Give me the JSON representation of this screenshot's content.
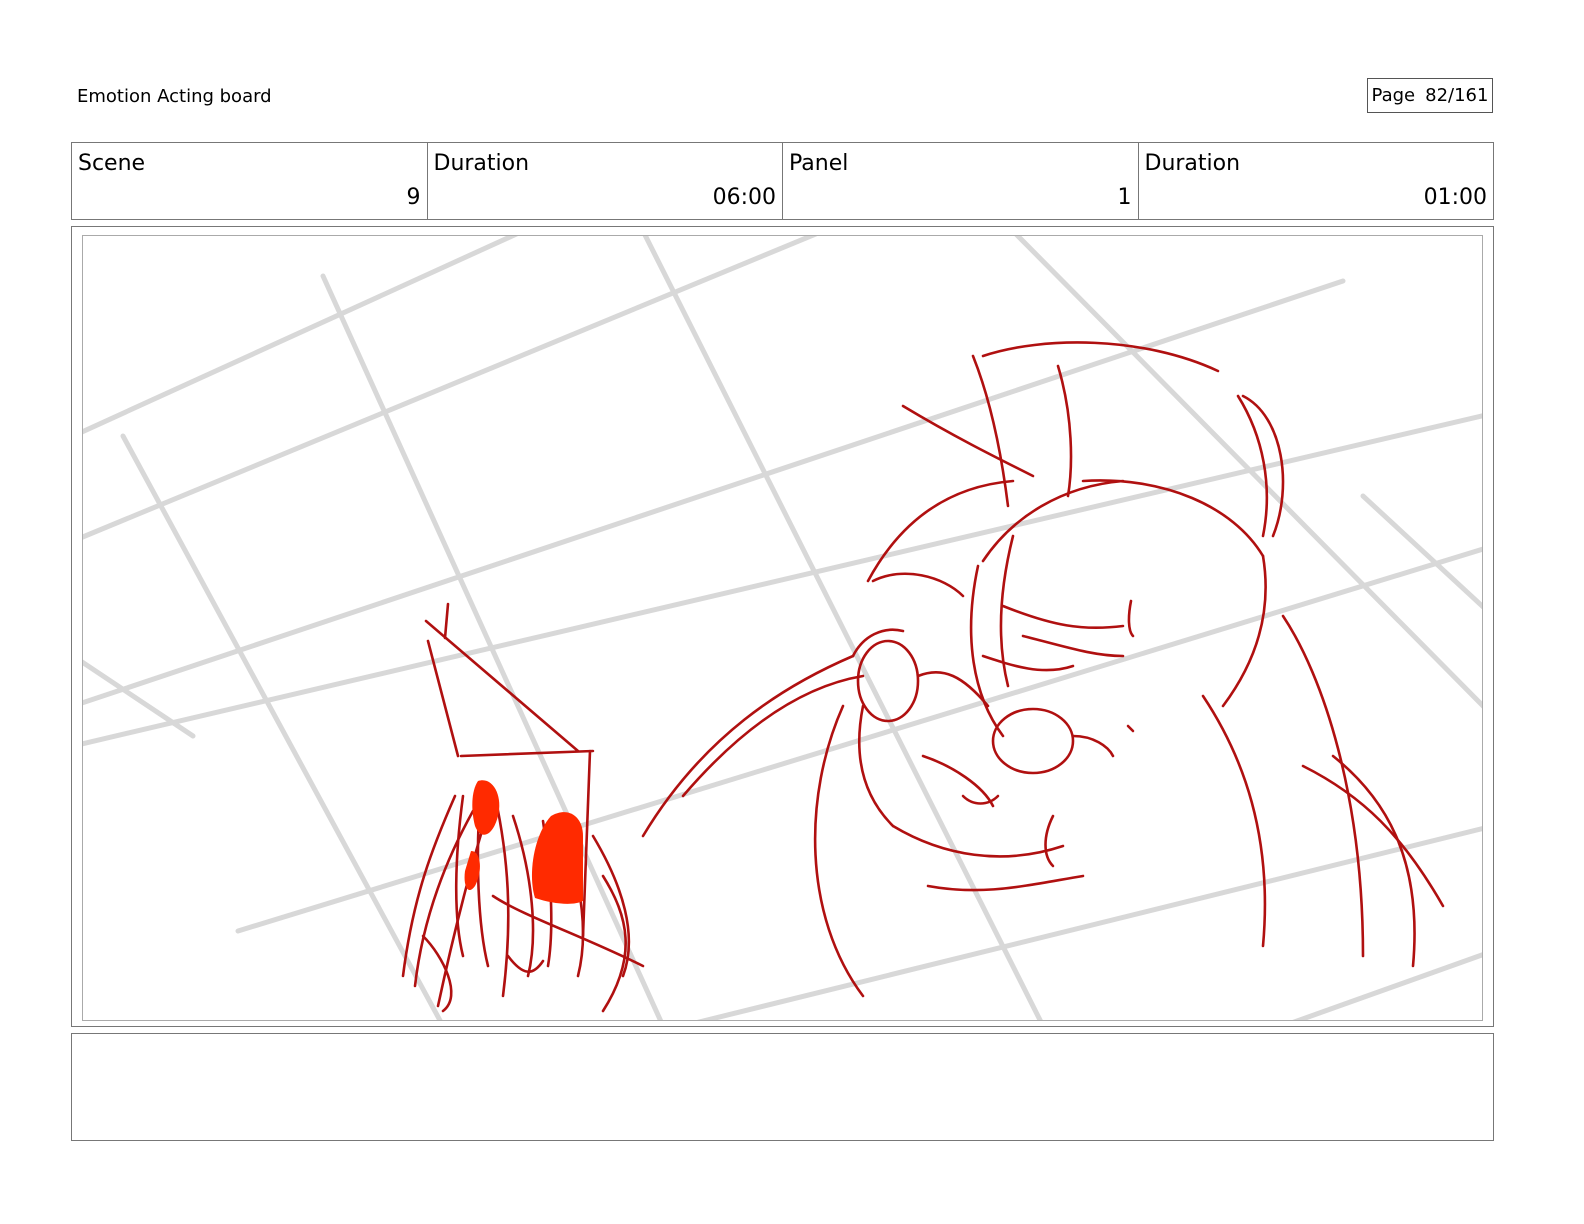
{
  "board": {
    "title": "Emotion Acting board",
    "page_label": "Page",
    "page_number": "82/161"
  },
  "info": {
    "scene_label": "Scene",
    "scene_value": "9",
    "scene_duration_label": "Duration",
    "scene_duration_value": "06:00",
    "panel_label": "Panel",
    "panel_value": "1",
    "panel_duration_label": "Duration",
    "panel_duration_value": "01:00"
  },
  "drawing": {
    "line_color": "#b01010",
    "fill_color": "#ff2a00",
    "grid_color": "#d8d8d8"
  },
  "notes": {
    "text": ""
  }
}
